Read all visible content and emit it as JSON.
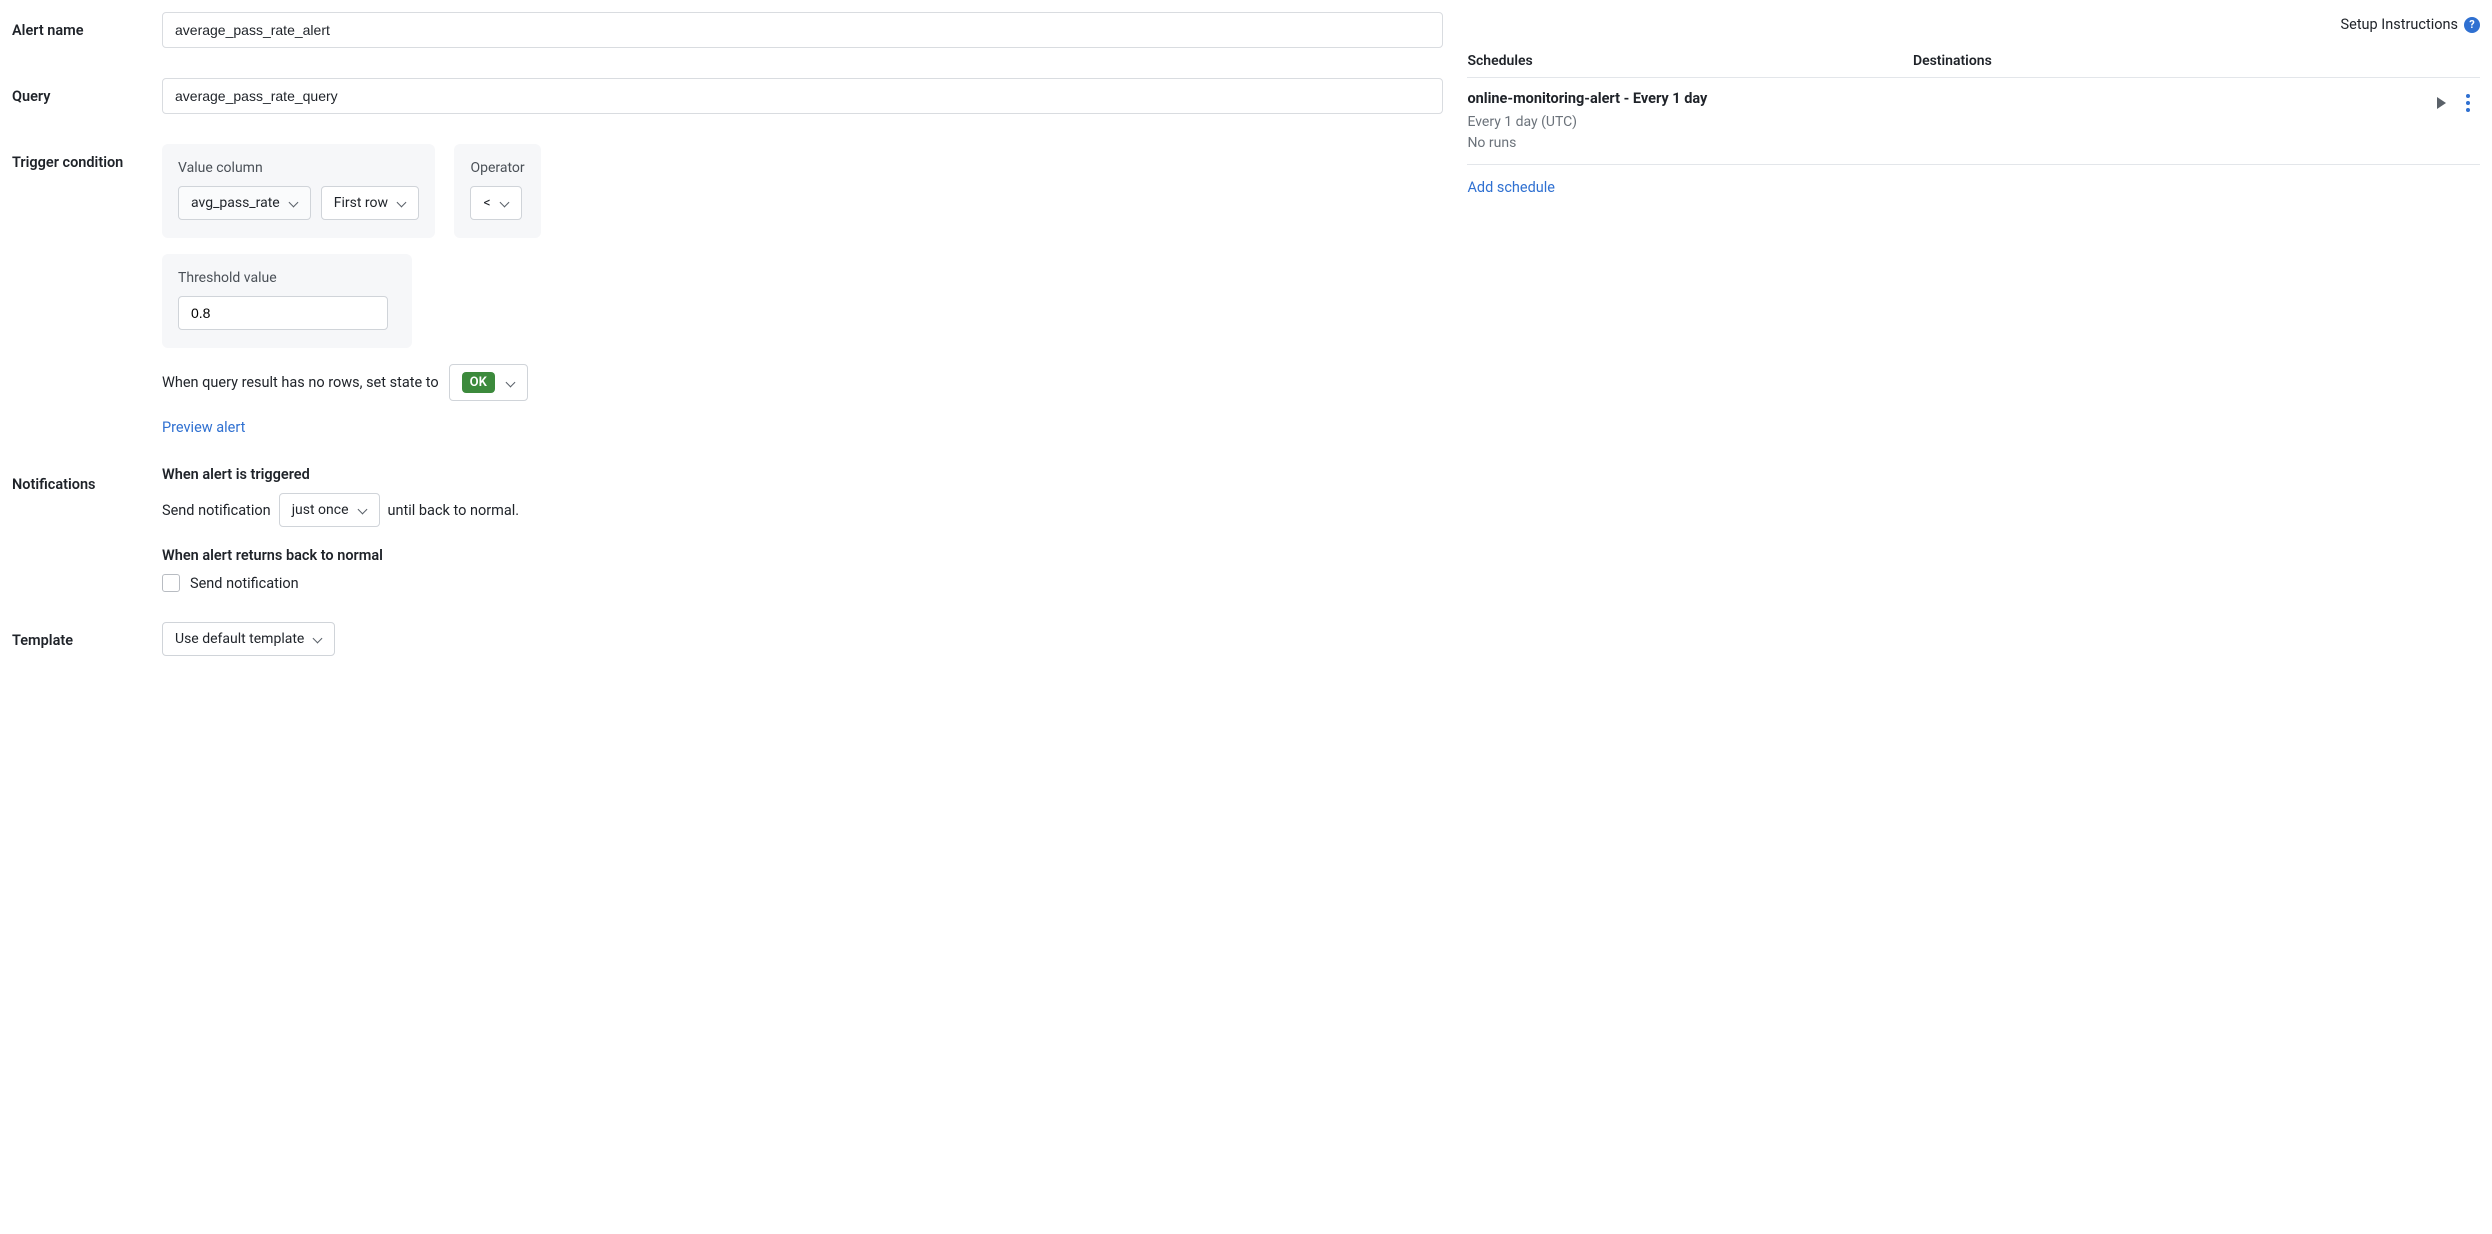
{
  "labels": {
    "alert_name": "Alert name",
    "query": "Query",
    "trigger_condition": "Trigger condition",
    "notifications": "Notifications",
    "template": "Template"
  },
  "alert_name": {
    "value": "average_pass_rate_alert"
  },
  "query": {
    "value": "average_pass_rate_query"
  },
  "trigger": {
    "value_column_label": "Value column",
    "value_column": "avg_pass_rate",
    "row_scope": "First row",
    "operator_label": "Operator",
    "operator": "<",
    "threshold_label": "Threshold value",
    "threshold_value": "0.8",
    "no_rows_text": "When query result has no rows, set state to",
    "no_rows_state": "OK",
    "preview_link": "Preview alert"
  },
  "notifications": {
    "triggered_heading": "When alert is triggered",
    "send_prefix": "Send notification",
    "frequency": "just once",
    "send_suffix": "until back to normal.",
    "normal_heading": "When alert returns back to normal",
    "normal_checkbox_label": "Send notification",
    "normal_checked": false
  },
  "template": {
    "selected": "Use default template"
  },
  "right": {
    "setup_instructions": "Setup Instructions",
    "schedules_header": "Schedules",
    "destinations_header": "Destinations",
    "schedule": {
      "title": "online-monitoring-alert - Every 1 day",
      "cadence": "Every 1 day (UTC)",
      "runs": "No runs"
    },
    "add_schedule": "Add schedule"
  }
}
